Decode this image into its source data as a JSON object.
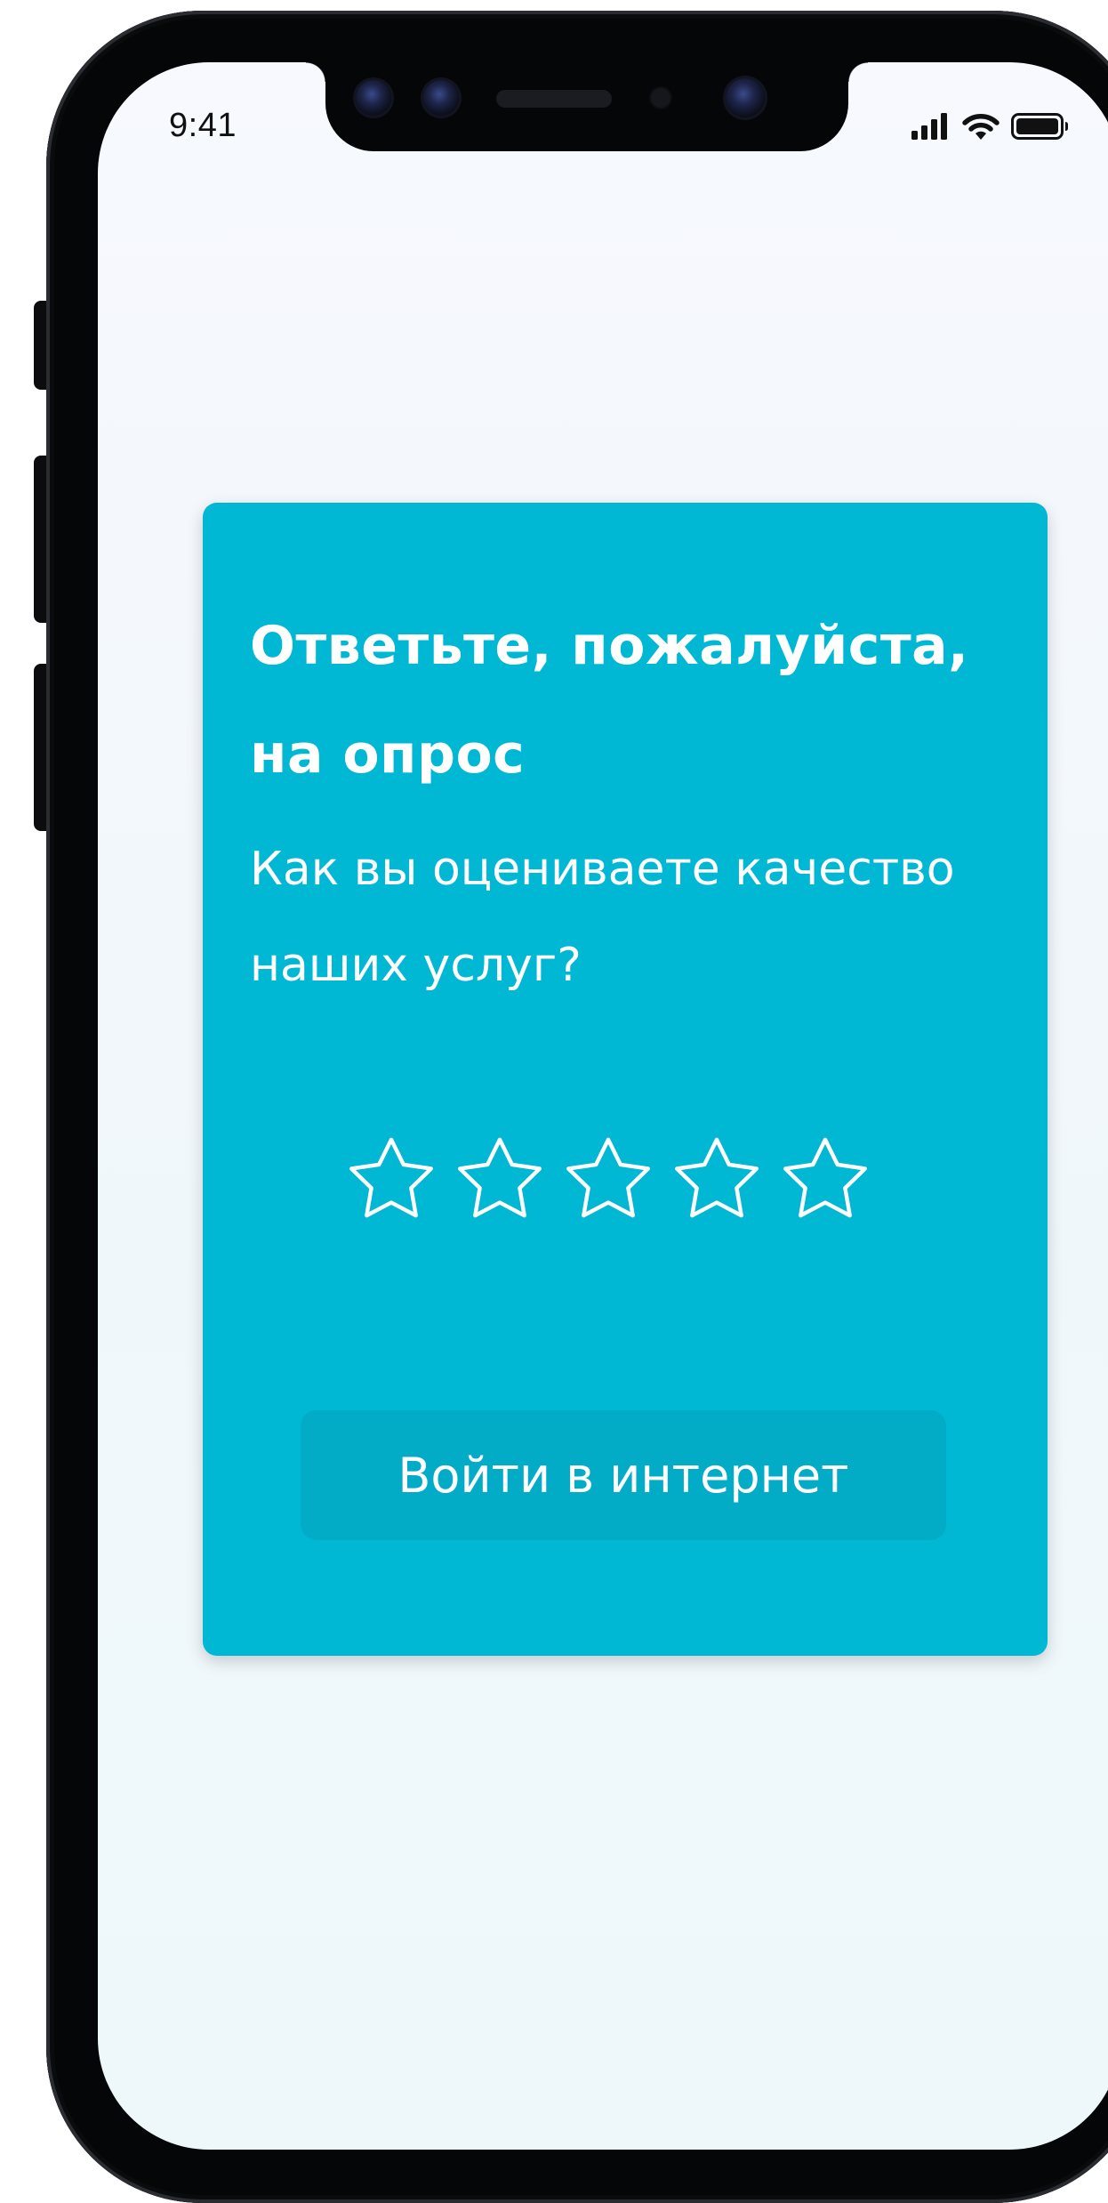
{
  "status_bar": {
    "time": "9:41",
    "signal_icon": "cellular-signal-icon",
    "wifi_icon": "wifi-icon",
    "battery_icon": "battery-icon"
  },
  "survey": {
    "title": "Ответьте, пожалуйста, на опрос",
    "question": "Как вы оцениваете качество наших услуг?",
    "rating": {
      "max": 5,
      "selected": 0,
      "icon": "star-outline-icon"
    },
    "button_label": "Войти в интернет"
  },
  "colors": {
    "card_background": "#00b8d4",
    "button_background": "#02acc7",
    "screen_background": "#f4f8fc",
    "text_on_card": "#ffffff"
  }
}
